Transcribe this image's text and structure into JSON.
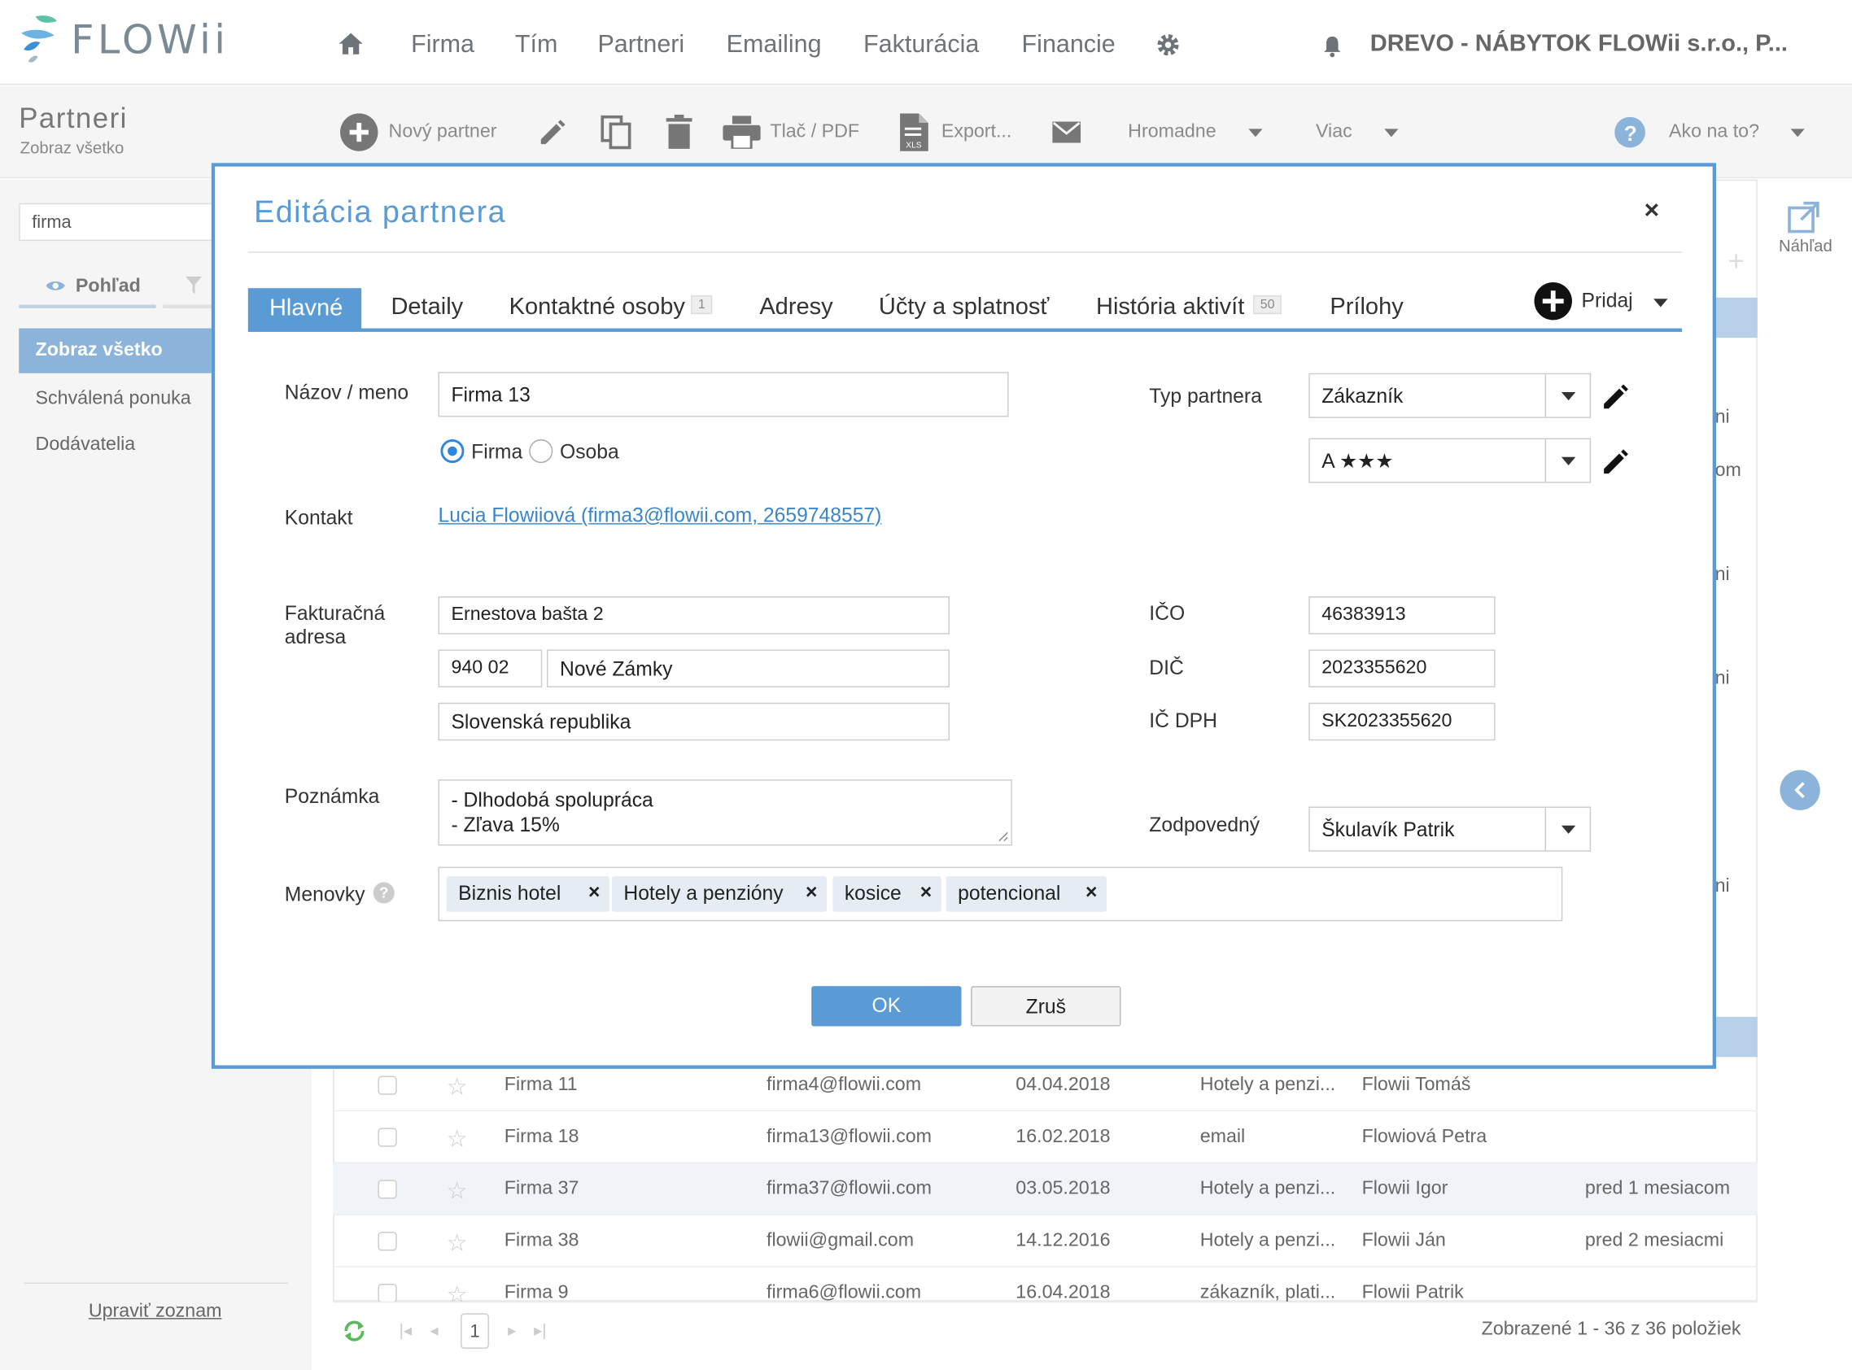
{
  "app": {
    "logo_text": "FLOWii",
    "company": "DREVO - NÁBYTOK FLOWii s.r.o., P..."
  },
  "nav": {
    "items": [
      "Firma",
      "Tím",
      "Partneri",
      "Emailing",
      "Fakturácia",
      "Financie"
    ]
  },
  "toolbar": {
    "title": "Partneri",
    "subtitle": "Zobraz všetko",
    "new_partner": "Nový partner",
    "print": "Tlač / PDF",
    "export": "Export...",
    "bulk": "Hromadne",
    "more": "Viac",
    "help": "Ako na to?"
  },
  "sidebar": {
    "search_value": "firma",
    "view_label": "Pohľad",
    "active_item": "Zobraz všetko",
    "items": [
      "Schválená ponuka",
      "Dodávatelia"
    ],
    "edit_list": "Upraviť zoznam"
  },
  "right_panel": {
    "preview_label": "Náhľad",
    "fragments": [
      "ni",
      "om",
      "ni",
      "ni",
      "ni"
    ]
  },
  "table": {
    "rows": [
      {
        "name": "Firma 11",
        "email": "firma4@flowii.com",
        "date": "04.04.2018",
        "tags": "Hotely a penzi...",
        "owner": "Flowii Tomáš",
        "activity": ""
      },
      {
        "name": "Firma 18",
        "email": "firma13@flowii.com",
        "date": "16.02.2018",
        "tags": "email",
        "owner": "Flowiová Petra",
        "activity": ""
      },
      {
        "name": "Firma 37",
        "email": "firma37@flowii.com",
        "date": "03.05.2018",
        "tags": "Hotely a penzi...",
        "owner": "Flowii Igor",
        "activity": "pred 1 mesiacom"
      },
      {
        "name": "Firma 38",
        "email": "flowii@gmail.com",
        "date": "14.12.2016",
        "tags": "Hotely a penzi...",
        "owner": "Flowii Ján",
        "activity": "pred 2 mesiacmi"
      },
      {
        "name": "Firma 9",
        "email": "firma6@flowii.com",
        "date": "16.04.2018",
        "tags": "zákazník, plati...",
        "owner": "Flowii Patrik",
        "activity": ""
      }
    ],
    "page": "1",
    "count_text": "Zobrazené 1 - 36 z 36 položiek"
  },
  "modal": {
    "title": "Editácia partnera",
    "close": "×",
    "tabs": {
      "main": "Hlavné",
      "details": "Detaily",
      "contacts": "Kontaktné osoby",
      "contacts_badge": "1",
      "addresses": "Adresy",
      "accounts": "Účty a splatnosť",
      "history": "História aktivít",
      "history_badge": "50",
      "attachments": "Prílohy",
      "add": "Pridaj"
    },
    "fields": {
      "name_label": "Názov / meno",
      "name_value": "Firma 13",
      "radio_company": "Firma",
      "radio_person": "Osoba",
      "contact_label": "Kontakt",
      "contact_value": "Lucia Flowiiová (firma3@flowii.com, 2659748557)",
      "billing_label": "Fakturačná adresa",
      "street": "Ernestova bašta 2",
      "zip": "940 02",
      "city": "Nové Zámky",
      "country": "Slovenská republika",
      "note_label": "Poznámka",
      "note_line1": "- Dlhodobá spolupráca",
      "note_line2": "- Zľava 15%",
      "tags_label": "Menovky",
      "tags": [
        "Biznis hotel",
        "Hotely a penzióny",
        "kosice",
        "potencional"
      ],
      "type_label": "Typ partnera",
      "type_value": "Zákazník",
      "rating_value": "A ★★★",
      "ico_label": "IČO",
      "ico_value": "46383913",
      "dic_label": "DIČ",
      "dic_value": "2023355620",
      "icdph_label": "IČ DPH",
      "icdph_value": "SK2023355620",
      "owner_label": "Zodpovedný",
      "owner_value": "Škulavík Patrik"
    },
    "ok": "OK",
    "cancel": "Zruš"
  }
}
